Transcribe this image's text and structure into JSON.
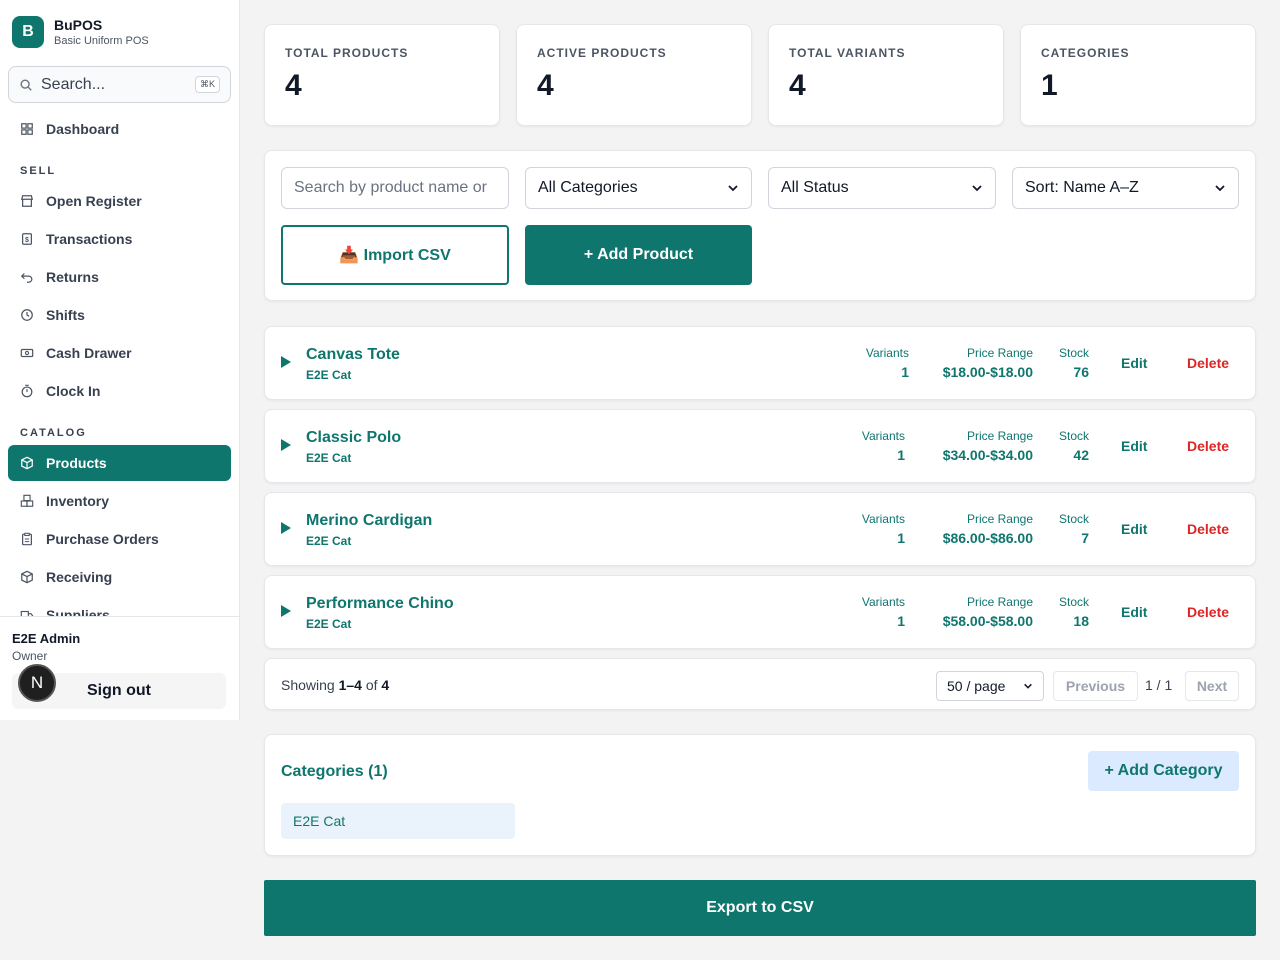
{
  "brand": {
    "logo_letter": "B",
    "name": "BuPOS",
    "subtitle": "Basic Uniform POS"
  },
  "search": {
    "placeholder": "Search...",
    "shortcut": "⌘K"
  },
  "nav": {
    "dashboard": "Dashboard",
    "sell_section": "SELL",
    "sell": [
      "Open Register",
      "Transactions",
      "Returns",
      "Shifts",
      "Cash Drawer",
      "Clock In"
    ],
    "catalog_section": "CATALOG",
    "catalog": [
      "Products",
      "Inventory",
      "Purchase Orders",
      "Receiving",
      "Suppliers"
    ]
  },
  "user": {
    "name": "E2E Admin",
    "role": "Owner",
    "signout": "Sign out",
    "avatar_letter": "N"
  },
  "stats": [
    {
      "label": "TOTAL PRODUCTS",
      "value": "4"
    },
    {
      "label": "ACTIVE PRODUCTS",
      "value": "4"
    },
    {
      "label": "TOTAL VARIANTS",
      "value": "4"
    },
    {
      "label": "CATEGORIES",
      "value": "1"
    }
  ],
  "filters": {
    "search_placeholder": "Search by product name or",
    "category": "All Categories",
    "status": "All Status",
    "sort": "Sort: Name A–Z",
    "import_label": "📥 Import CSV",
    "add_label": "+ Add Product"
  },
  "columns": {
    "variants": "Variants",
    "price_range": "Price Range",
    "stock": "Stock",
    "edit": "Edit",
    "delete": "Delete"
  },
  "products": [
    {
      "name": "Canvas Tote",
      "category": "E2E Cat",
      "variants": "1",
      "price_range": "$18.00-$18.00",
      "stock": "76"
    },
    {
      "name": "Classic Polo",
      "category": "E2E Cat",
      "variants": "1",
      "price_range": "$34.00-$34.00",
      "stock": "42"
    },
    {
      "name": "Merino Cardigan",
      "category": "E2E Cat",
      "variants": "1",
      "price_range": "$86.00-$86.00",
      "stock": "7"
    },
    {
      "name": "Performance Chino",
      "category": "E2E Cat",
      "variants": "1",
      "price_range": "$58.00-$58.00",
      "stock": "18"
    }
  ],
  "pager": {
    "prefix": "Showing ",
    "range": "1–4",
    "of": " of ",
    "total": "4",
    "per_page": "50 / page",
    "previous": "Previous",
    "page": "1 / 1",
    "next": "Next"
  },
  "categories": {
    "title": "Categories (1)",
    "add_label": "+ Add Category",
    "items": [
      "E2E Cat"
    ]
  },
  "export_label": "Export to CSV",
  "colors": {
    "primary": "#0f766e",
    "danger": "#dc2626",
    "chip": "#eaf2fb",
    "add_category_bg": "#dbeafe"
  }
}
